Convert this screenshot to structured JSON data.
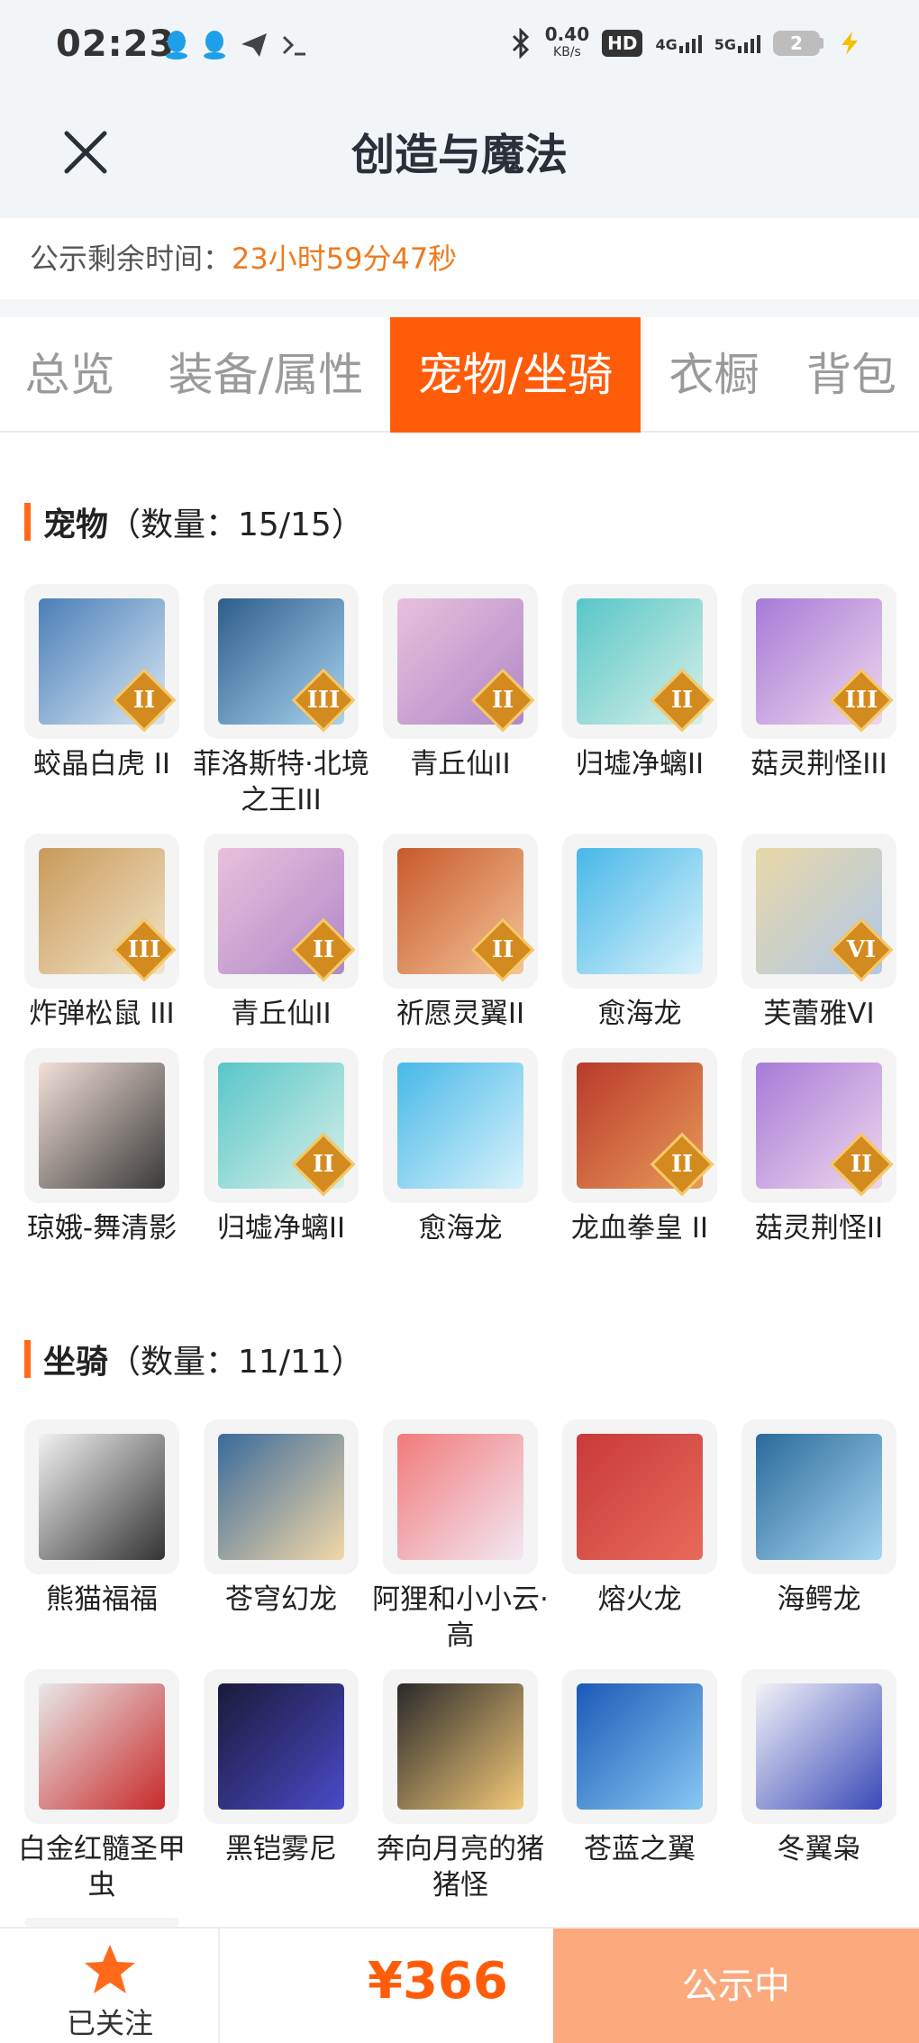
{
  "status_bar": {
    "time": "02:23",
    "net_speed": "0.40",
    "net_speed_unit": "KB/s",
    "hd_badge": "HD",
    "sim1": "4G",
    "sim2": "5G",
    "battery": "2"
  },
  "header": {
    "title": "创造与魔法"
  },
  "countdown": {
    "label": "公示剩余时间：",
    "value": "23小时59分47秒"
  },
  "tabs": [
    {
      "label": "总览",
      "active": false
    },
    {
      "label": "装备/属性",
      "active": false
    },
    {
      "label": "宠物/坐骑",
      "active": true
    },
    {
      "label": "衣橱",
      "active": false
    },
    {
      "label": "背包",
      "active": false
    }
  ],
  "pets": {
    "title": "宠物",
    "count": "（数量：15/15）",
    "items": [
      {
        "name": "蛟晶白虎 II",
        "rank": "II"
      },
      {
        "name": "菲洛斯特·北境之王III",
        "rank": "III"
      },
      {
        "name": "青丘仙II",
        "rank": "II"
      },
      {
        "name": "归墟净螭II",
        "rank": "II"
      },
      {
        "name": "菇灵荆怪III",
        "rank": "III"
      },
      {
        "name": "炸弹松鼠 III",
        "rank": "III"
      },
      {
        "name": "青丘仙II",
        "rank": "II"
      },
      {
        "name": "祈愿灵翼II",
        "rank": "II"
      },
      {
        "name": "愈海龙",
        "rank": ""
      },
      {
        "name": "芙蕾雅VI",
        "rank": "VI"
      },
      {
        "name": "琼娥-舞清影",
        "rank": ""
      },
      {
        "name": "归墟净螭II",
        "rank": "II"
      },
      {
        "name": "愈海龙",
        "rank": ""
      },
      {
        "name": "龙血拳皇 II",
        "rank": "II"
      },
      {
        "name": "菇灵荆怪II",
        "rank": "II"
      }
    ]
  },
  "mounts": {
    "title": "坐骑",
    "count": "（数量：11/11）",
    "items": [
      {
        "name": "熊猫福福"
      },
      {
        "name": "苍穹幻龙"
      },
      {
        "name": "阿狸和小小云·高"
      },
      {
        "name": "熔火龙"
      },
      {
        "name": "海鳄龙"
      },
      {
        "name": "白金红髓圣甲虫"
      },
      {
        "name": "黑铠雾尼"
      },
      {
        "name": "奔向月亮的猪猪怪"
      },
      {
        "name": "苍蓝之翼"
      },
      {
        "name": "冬翼枭"
      }
    ]
  },
  "bottom": {
    "follow_label": "已关注",
    "price": "¥366",
    "cta": "公示中"
  },
  "colors": {
    "accent": "#ff5c0a",
    "countdown": "#f07a1d",
    "cta_bg": "#fba97d"
  }
}
